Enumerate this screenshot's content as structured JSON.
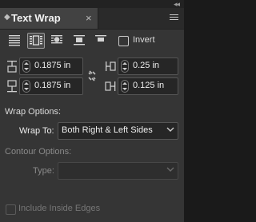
{
  "panel": {
    "title": "Text Wrap",
    "tab_chevron": "◆",
    "close_glyph": "×",
    "collapse_glyph": "◂◂"
  },
  "wrap_modes": [
    {
      "name": "no-text-wrap-icon",
      "selected": false
    },
    {
      "name": "wrap-around-bounding-box-icon",
      "selected": true
    },
    {
      "name": "wrap-around-object-shape-icon",
      "selected": false
    },
    {
      "name": "jump-object-icon",
      "selected": false
    },
    {
      "name": "jump-to-next-column-icon",
      "selected": false
    }
  ],
  "invert": {
    "label": "Invert",
    "checked": false
  },
  "offsets": {
    "top": "0.1875 in",
    "bottom": "0.1875 in",
    "left": "0.25 in",
    "right": "0.125 in"
  },
  "wrap_options": {
    "heading": "Wrap Options:",
    "wrap_to_label": "Wrap To:",
    "wrap_to_value": "Both Right & Left Sides"
  },
  "contour_options": {
    "heading": "Contour Options:",
    "type_label": "Type:",
    "type_value": ""
  },
  "include_inside_edges": {
    "label": "Include Inside Edges",
    "checked": false,
    "enabled": false
  }
}
